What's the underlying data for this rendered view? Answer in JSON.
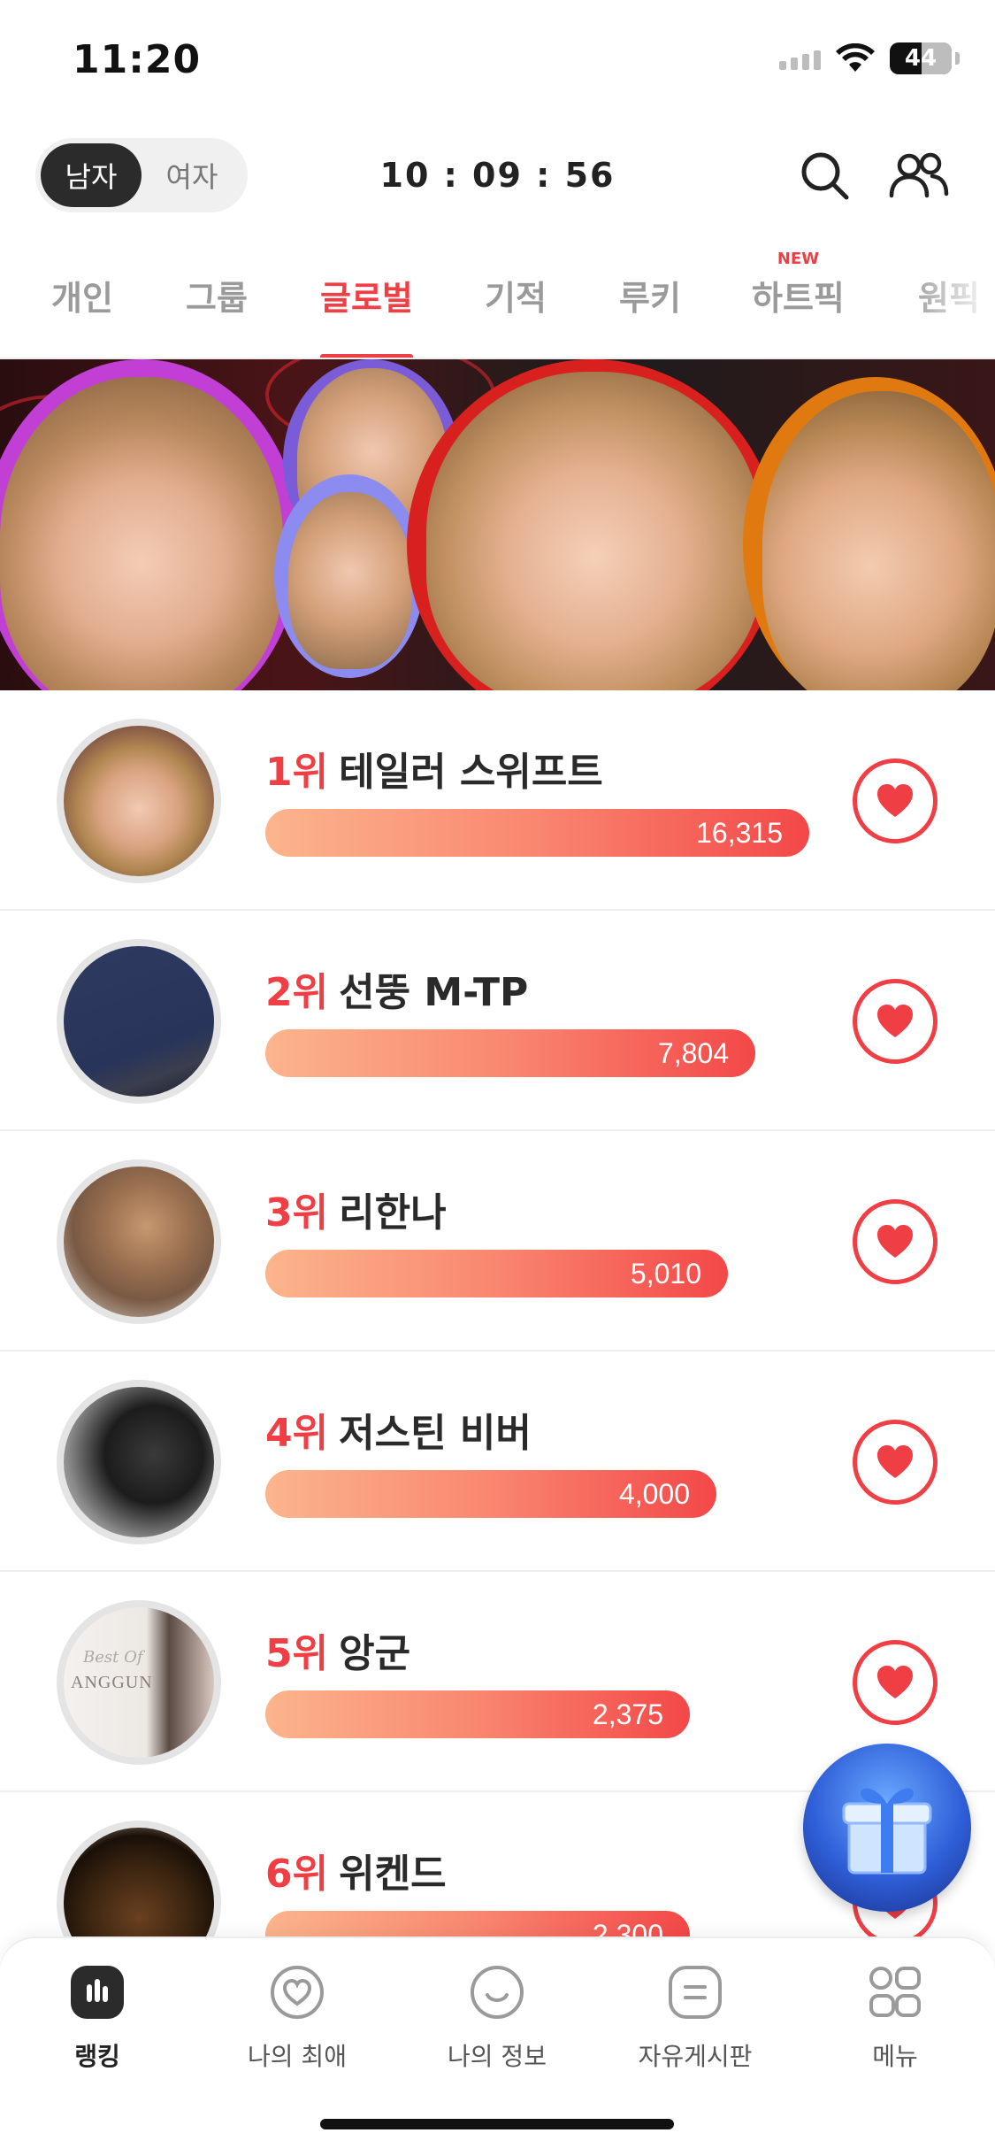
{
  "status_bar": {
    "time": "11:20",
    "battery": "44"
  },
  "header": {
    "gender_options": [
      "남자",
      "여자"
    ],
    "selected_gender": "남자",
    "clock": "10 : 09 : 56"
  },
  "tabs": [
    {
      "label": "개인",
      "active": false,
      "new": false
    },
    {
      "label": "그룹",
      "active": false,
      "new": false
    },
    {
      "label": "글로벌",
      "active": true,
      "new": false
    },
    {
      "label": "기적",
      "active": false,
      "new": false
    },
    {
      "label": "루키",
      "active": false,
      "new": false
    },
    {
      "label": "하트픽",
      "active": false,
      "new": true,
      "badge": "NEW"
    },
    {
      "label": "원픽",
      "active": false,
      "new": false
    }
  ],
  "ranking": [
    {
      "rank": "1위",
      "name": "테일러 스위프트",
      "votes": "16,315",
      "share": 1.0
    },
    {
      "rank": "2위",
      "name": "선뚱 M-TP",
      "votes": "7,804",
      "share": 0.9
    },
    {
      "rank": "3위",
      "name": "리한나",
      "votes": "5,010",
      "share": 0.85
    },
    {
      "rank": "4위",
      "name": "저스틴 비버",
      "votes": "4,000",
      "share": 0.83
    },
    {
      "rank": "5위",
      "name": "앙군",
      "votes": "2,375",
      "share": 0.78
    },
    {
      "rank": "6위",
      "name": "위켄드",
      "votes": "2,300",
      "share": 0.78
    }
  ],
  "avatar_text": {
    "anggun_caption": "Best Of",
    "anggun_name": "ANGGUN"
  },
  "bottom_nav": [
    {
      "label": "랭킹",
      "icon": "chart-bars-icon",
      "active": true
    },
    {
      "label": "나의 최애",
      "icon": "heart-outline-icon",
      "active": false
    },
    {
      "label": "나의 정보",
      "icon": "smile-icon",
      "active": false
    },
    {
      "label": "자유게시판",
      "icon": "board-icon",
      "active": false
    },
    {
      "label": "메뉴",
      "icon": "menu-grid-icon",
      "active": false
    }
  ],
  "colors": {
    "accent": "#f03e45",
    "bar_start": "#fbb58c",
    "bar_end": "#f34848"
  }
}
